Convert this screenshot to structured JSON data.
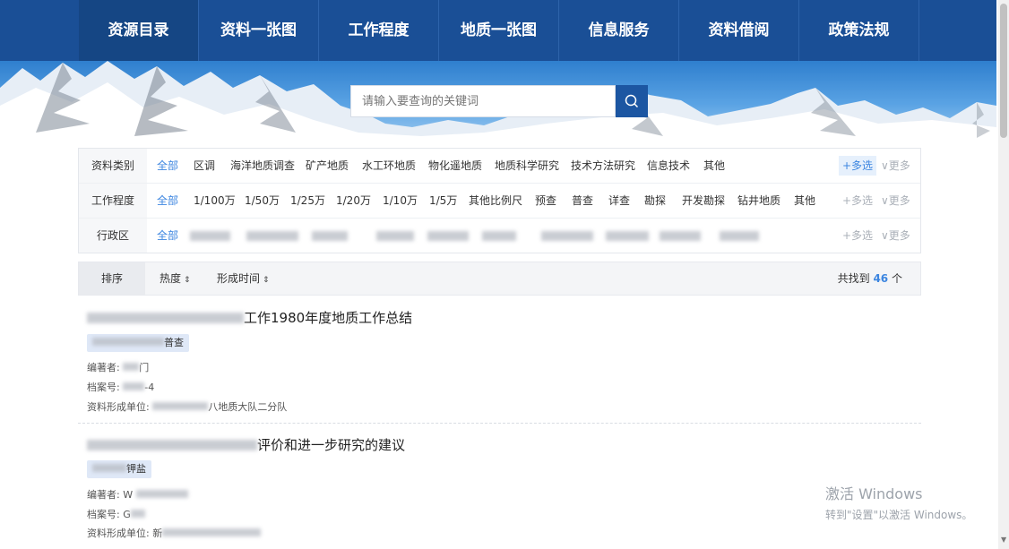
{
  "nav": {
    "items": [
      {
        "label": "资源目录",
        "active": true
      },
      {
        "label": "资料一张图",
        "active": false
      },
      {
        "label": "工作程度",
        "active": false
      },
      {
        "label": "地质一张图",
        "active": false
      },
      {
        "label": "信息服务",
        "active": false
      },
      {
        "label": "资料借阅",
        "active": false
      },
      {
        "label": "政策法规",
        "active": false
      }
    ]
  },
  "search": {
    "placeholder": "请输入要查询的关键词",
    "button_icon": "search-icon"
  },
  "filters": {
    "category": {
      "label": "资料类别",
      "options": [
        "全部",
        "区调",
        "海洋地质调查",
        "矿产地质",
        "水工环地质",
        "物化遥地质",
        "地质科学研究",
        "技术方法研究",
        "信息技术",
        "其他"
      ],
      "multi": "+多选",
      "more": "∨更多"
    },
    "level": {
      "label": "工作程度",
      "options": [
        "全部",
        "1/100万",
        "1/50万",
        "1/25万",
        "1/20万",
        "1/10万",
        "1/5万",
        "其他比例尺",
        "预查",
        "普查",
        "详查",
        "勘探",
        "开发勘探",
        "钻井地质",
        "其他"
      ],
      "multi": "+多选",
      "more": "∨更多"
    },
    "region": {
      "label": "行政区",
      "options": [
        "全部"
      ],
      "multi": "+多选",
      "more": "∨更多"
    }
  },
  "sort": {
    "label": "排序",
    "options": [
      "热度",
      "形成时间"
    ],
    "total_prefix": "共找到",
    "total_count": "46",
    "total_suffix": "个"
  },
  "results": [
    {
      "title_visible": "工作1980年度地质工作总结",
      "tag_visible": "普查",
      "author_label": "编著者:",
      "author_visible": "门",
      "archive_label": "档案号:",
      "archive_visible": "-4",
      "unit_label": "资料形成单位:",
      "unit_visible": "八地质大队二分队"
    },
    {
      "title_visible": "评价和进一步研究的建议",
      "tag_visible": "钾盐",
      "author_label": "编著者:",
      "author_visible": "W",
      "archive_label": "档案号:",
      "archive_visible": "G",
      "unit_label": "资料形成单位:",
      "unit_visible": "新"
    }
  ],
  "watermark": {
    "line1": "激活 Windows",
    "line2": "转到\"设置\"以激活 Windows。"
  },
  "colors": {
    "nav_bg": "#1a4f96",
    "nav_active": "#154684",
    "accent": "#3d86e0",
    "search_button": "#1c56a2"
  }
}
